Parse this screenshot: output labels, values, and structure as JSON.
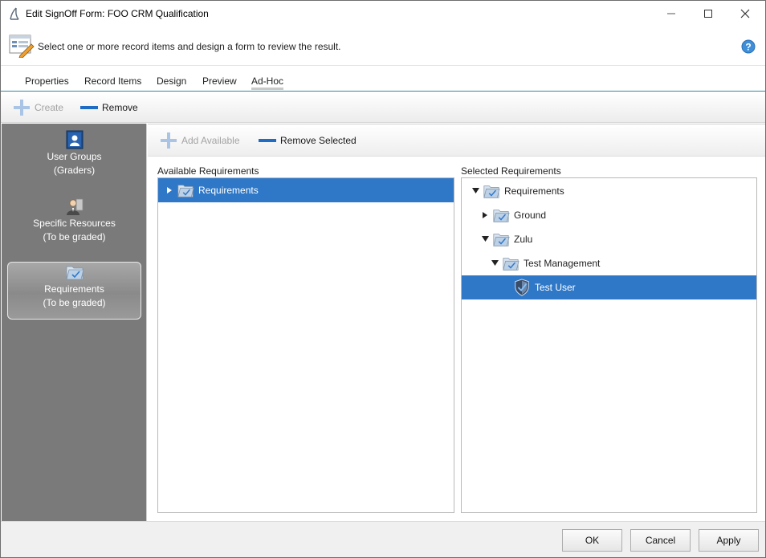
{
  "window": {
    "title": "Edit SignOff Form: FOO CRM Qualification",
    "controls": {
      "minimize": "—",
      "maximize": "☐",
      "close": "✕"
    }
  },
  "header": {
    "instruction": "Select one or more record items and design a form to review the result.",
    "help_icon": "help-question-icon"
  },
  "tabs": [
    {
      "label": "Properties",
      "active": false
    },
    {
      "label": "Record Items",
      "active": false
    },
    {
      "label": "Design",
      "active": false
    },
    {
      "label": "Preview",
      "active": false
    },
    {
      "label": "Ad-Hoc",
      "active": true
    }
  ],
  "toolbar": {
    "create_label": "Create",
    "create_enabled": false,
    "remove_label": "Remove"
  },
  "sidebar": {
    "items": [
      {
        "title": "User Groups",
        "subtitle": "(Graders)",
        "icon": "user-group-icon",
        "selected": false
      },
      {
        "title": "Specific Resources",
        "subtitle": "(To be graded)",
        "icon": "person-icon",
        "selected": false
      },
      {
        "title": "Requirements",
        "subtitle": "(To be graded)",
        "icon": "requirement-folder-icon",
        "selected": true
      }
    ]
  },
  "subtoolbar": {
    "add_available_label": "Add Available",
    "add_available_enabled": false,
    "remove_selected_label": "Remove Selected"
  },
  "available": {
    "label": "Available Requirements",
    "items": [
      {
        "label": "Requirements",
        "expanded": false,
        "selected": true
      }
    ]
  },
  "selected": {
    "label": "Selected Requirements",
    "items": [
      {
        "label": "Requirements",
        "expanded": true,
        "selected": false
      },
      {
        "label": "Ground",
        "expanded": false,
        "selected": false
      },
      {
        "label": "Zulu",
        "expanded": true,
        "selected": false
      },
      {
        "label": "Test Management",
        "expanded": true,
        "selected": false
      },
      {
        "label": "Test User",
        "leaf": true,
        "selected": true
      }
    ]
  },
  "footer": {
    "ok_label": "OK",
    "cancel_label": "Cancel",
    "apply_label": "Apply"
  },
  "colors": {
    "accent": "#2f78c8",
    "sidebar_bg": "#7a7a7a",
    "tab_underline": "#2f8aa6"
  }
}
